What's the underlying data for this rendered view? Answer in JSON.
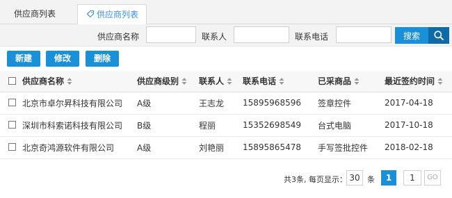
{
  "tabs": [
    {
      "label": "供应商列表",
      "active": false
    },
    {
      "label": "供应商列表",
      "active": true
    }
  ],
  "search": {
    "supplier_name_label": "供应商名称",
    "supplier_name_value": "",
    "contact_label": "联系人",
    "contact_value": "",
    "phone_label": "联系电话",
    "phone_value": "",
    "search_button": "搜索"
  },
  "actions": {
    "new": "新建",
    "edit": "修改",
    "delete": "删除"
  },
  "table": {
    "headers": [
      "供应商名称",
      "供应商级别",
      "联系人",
      "联系电话",
      "已采商品",
      "最近签约时间"
    ],
    "rows": [
      {
        "name": "北京市卓尔昇科技有限公司",
        "level": "A级",
        "contact": "王志龙",
        "phone": "15895968596",
        "goods": "签章控件",
        "date": "2017-04-18"
      },
      {
        "name": "深圳市科索诺科技有限公司",
        "level": "B级",
        "contact": "程丽",
        "phone": "15352698549",
        "goods": "台式电脑",
        "date": "2017-10-18"
      },
      {
        "name": "北京奇鸿源软件有限公司",
        "level": "A级",
        "contact": "刘艳丽",
        "phone": "15895865478",
        "goods": "手写签批控件",
        "date": "2018-02-18"
      }
    ]
  },
  "pagination": {
    "summary": "共3条, 每页显示：",
    "page_size": "30",
    "unit": "条",
    "current_page": "1",
    "goto_page": "1",
    "go_label": "GO"
  },
  "colors": {
    "accent": "#1a90d8",
    "search_icon_bg": "#0f6aa8",
    "tab_active_text": "#3a8ee6"
  }
}
